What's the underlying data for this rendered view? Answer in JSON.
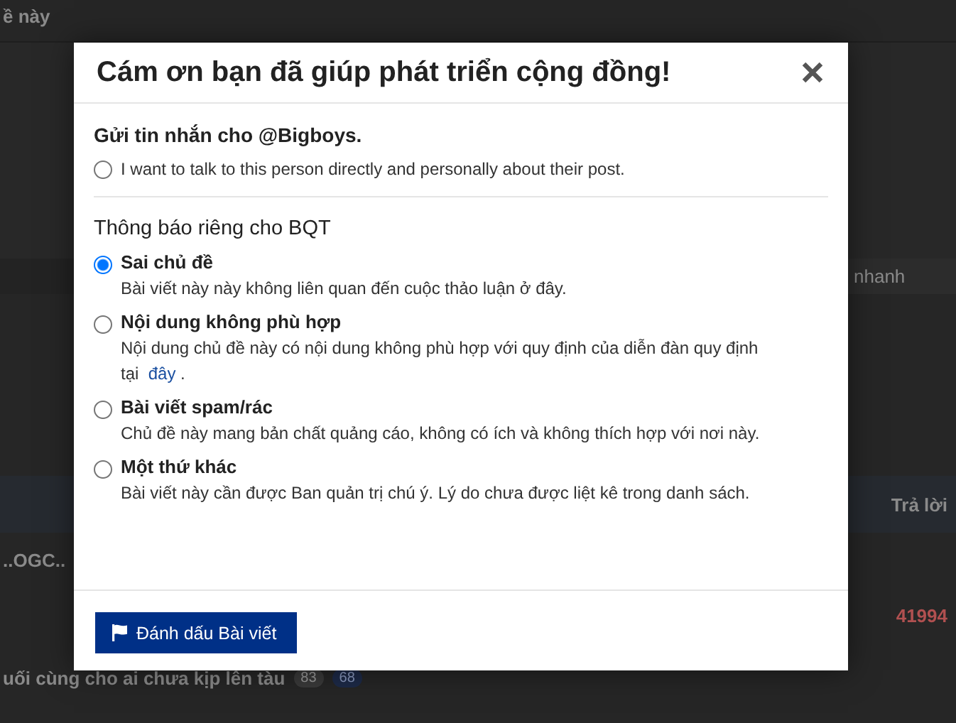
{
  "background": {
    "header_text": "ề này",
    "search_button": "nhanh",
    "column_header": "Trả lời",
    "thread_title": "..OGC..",
    "reply_count": "41994",
    "thread_title_2": "uối cùng cho ai chưa kịp lên tàu",
    "badges": [
      "83",
      "68"
    ]
  },
  "dialog": {
    "title": "Cám ơn bạn đã giúp phát triển cộng đồng!",
    "message_section": {
      "heading": "Gửi tin nhắn cho @Bigboys.",
      "option": {
        "label": "I want to talk to this person directly and personally about their post.",
        "selected": false
      }
    },
    "report_section": {
      "heading": "Thông báo riêng cho BQT",
      "options": [
        {
          "label": "Sai chủ đề",
          "description": "Bài viết này này không liên quan đến cuộc thảo luận ở đây.",
          "selected": true
        },
        {
          "label": "Nội dung không phù hợp",
          "description": "Nội dung chủ đề này có nội dung không phù hợp với quy định của diễn đàn quy định tại",
          "link": "đây",
          "suffix": ".",
          "selected": false
        },
        {
          "label": "Bài viết spam/rác",
          "description": "Chủ đề này mang bản chất quảng cáo, không có ích và không thích hợp với nơi này.",
          "selected": false
        },
        {
          "label": "Một thứ khác",
          "description": "Bài viết này cần được Ban quản trị chú ý. Lý do chưa được liệt kê trong danh sách.",
          "selected": false
        }
      ]
    },
    "submit_button": "Đánh dấu Bài viết"
  }
}
